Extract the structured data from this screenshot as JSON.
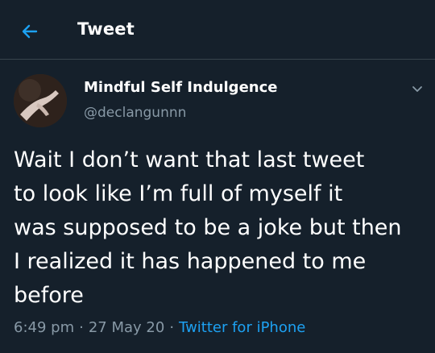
{
  "header": {
    "title": "Tweet",
    "back_icon": "arrow-left-icon",
    "accent_color": "#1da1f2"
  },
  "tweet": {
    "display_name": "Mindful Self Indulgence",
    "handle": "@declangunnn",
    "text": "Wait I don’t want that last tweet\nto look like I’m full of myself it\nwas supposed to be a joke but then\nI realized it has happened to me\nbefore",
    "time": "6:49 pm",
    "separator": "·",
    "date": "27 May 20",
    "source": "Twitter for iPhone",
    "more_icon": "chevron-down-icon"
  }
}
